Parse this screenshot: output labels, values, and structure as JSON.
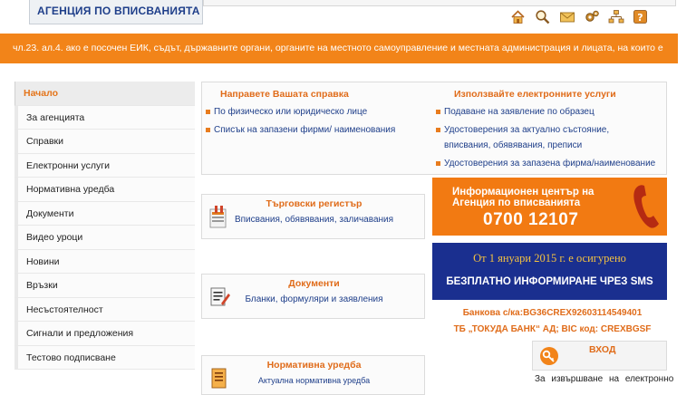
{
  "header": {
    "logo_text": "АГЕНЦИЯ ПО ВПИСВАНИЯТА",
    "icons": [
      "home-icon",
      "search-icon",
      "mail-icon",
      "settings-icon",
      "sitemap-icon",
      "help-icon"
    ]
  },
  "ticker": {
    "text": "чл.23. ал.4. ако е посочен ЕИК, съдът, държавните органи, органите на местното самоуправление и местната администрация и лицата, на които е"
  },
  "sidebar": {
    "items": [
      {
        "label": "Начало"
      },
      {
        "label": "За агенцията"
      },
      {
        "label": "Справки"
      },
      {
        "label": "Електронни услуги"
      },
      {
        "label": "Нормативна уредба"
      },
      {
        "label": "Документи"
      },
      {
        "label": "Видео уроци"
      },
      {
        "label": "Новини"
      },
      {
        "label": "Връзки"
      },
      {
        "label": "Несъстоятелност"
      },
      {
        "label": "Сигнали и предложения"
      },
      {
        "label": "Тестово подписване"
      }
    ]
  },
  "main": {
    "left_section": {
      "title": "Направете Вашата справка",
      "links": [
        "По физическо или юридическо лице",
        "Списък на запазени фирми/ наименования"
      ]
    },
    "right_section": {
      "title": "Използвайте електронните услуги",
      "links": [
        "Подаване на заявление по образец",
        "Удостоверения за актуално състояние,",
        "вписвания, обявявания, преписи",
        "Удостоверения за запазена фирма/наименование"
      ]
    },
    "cards": [
      {
        "title": "Търговски регистър",
        "subtitle": "Вписвания, обявявания, заличавания"
      },
      {
        "title": "Документи",
        "subtitle": "Бланки, формуляри и заявления"
      },
      {
        "title": "Нормативна уредба",
        "subtitle": "Актуална нормативна уредба"
      }
    ]
  },
  "right": {
    "info_line1": "Информационен център на",
    "info_line2": "Агенция по вписванията",
    "info_phone": "0700 12107",
    "sms_line1": "От 1 януари 2015 г. е осигурено",
    "sms_line2": "БЕЗПЛАТНО ИНФОРМИРАНЕ ЧРЕЗ SMS",
    "bank_line1": "Банкова с/ка:BG36CREX92603114549401",
    "bank_line2": "ТБ „ТОКУДА БАНК“ АД; BIC код: CREXBGSF",
    "login_label": "ВХОД",
    "bottom_text": "За извършване на електронно"
  },
  "colors": {
    "accent": "#f28419",
    "link": "#1f3f8a",
    "sms_bg": "#1a2f8f"
  }
}
